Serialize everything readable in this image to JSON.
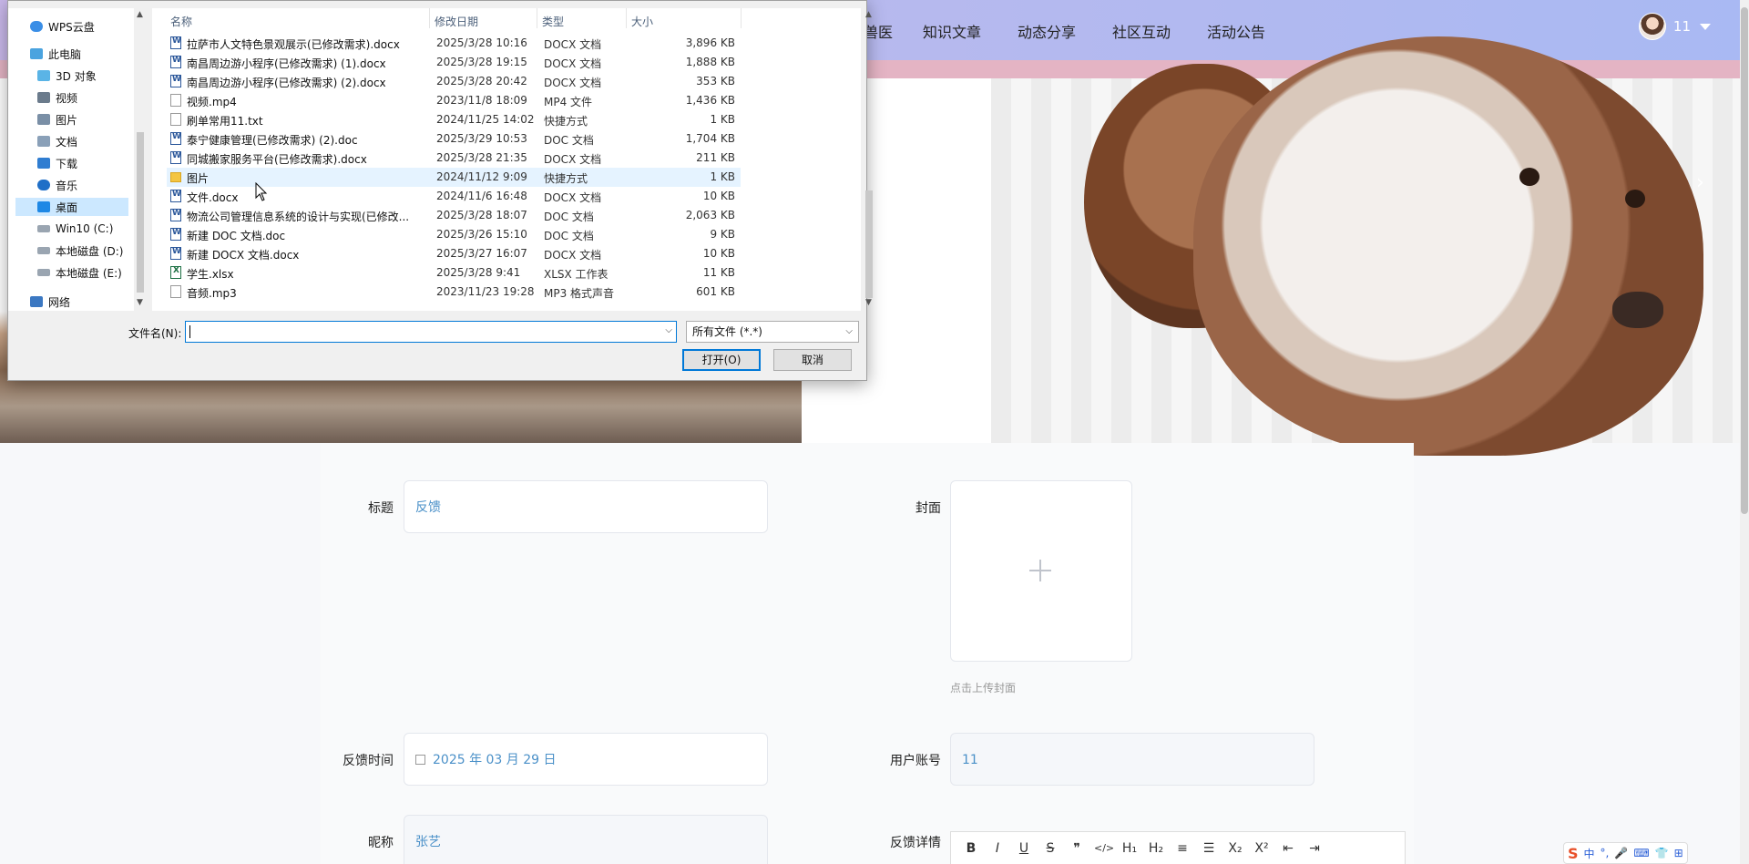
{
  "nav": {
    "items": [
      {
        "label": "兽医"
      },
      {
        "label": "知识文章"
      },
      {
        "label": "动态分享"
      },
      {
        "label": "社区互动"
      },
      {
        "label": "活动公告"
      }
    ],
    "user": "11"
  },
  "form": {
    "title_label": "标题",
    "title_value": "反馈",
    "cover_label": "封面",
    "cover_hint": "点击上传封面",
    "time_label": "反馈时间",
    "time_value": "2025 年 03 月 29 日",
    "account_label": "用户账号",
    "account_value": "11",
    "nickname_label": "昵称",
    "nickname_value": "张艺",
    "detail_label": "反馈详情"
  },
  "editor_toolbar": [
    "B",
    "I",
    "U",
    "S",
    "❞",
    "</>",
    "H₁",
    "H₂",
    "≡",
    "☰",
    "X₂",
    "X²",
    "⇤",
    "⇥"
  ],
  "ime": {
    "label": "中"
  },
  "dialog": {
    "nav_items": [
      {
        "label": "WPS云盘",
        "icon": "cloud-icon"
      },
      {
        "label": "此电脑",
        "icon": "computer-icon"
      },
      {
        "label": "3D 对象",
        "icon": "cube-icon"
      },
      {
        "label": "视频",
        "icon": "video-icon"
      },
      {
        "label": "图片",
        "icon": "picture-icon"
      },
      {
        "label": "文档",
        "icon": "document-icon"
      },
      {
        "label": "下载",
        "icon": "download-icon"
      },
      {
        "label": "音乐",
        "icon": "music-icon"
      },
      {
        "label": "桌面",
        "icon": "desktop-icon"
      },
      {
        "label": "Win10 (C:)",
        "icon": "drive-icon"
      },
      {
        "label": "本地磁盘 (D:)",
        "icon": "drive-icon"
      },
      {
        "label": "本地磁盘 (E:)",
        "icon": "drive-icon"
      },
      {
        "label": "网络",
        "icon": "network-icon"
      }
    ],
    "columns": {
      "name": "名称",
      "date": "修改日期",
      "type": "类型",
      "size": "大小"
    },
    "files": [
      {
        "name": "拉萨市人文特色景观展示(已修改需求).docx",
        "date": "2025/3/28 10:16",
        "type": "DOCX 文档",
        "size": "3,896 KB",
        "icon": "word"
      },
      {
        "name": "南昌周边游小程序(已修改需求) (1).docx",
        "date": "2025/3/28 19:15",
        "type": "DOCX 文档",
        "size": "1,888 KB",
        "icon": "word"
      },
      {
        "name": "南昌周边游小程序(已修改需求) (2).docx",
        "date": "2025/3/28 20:42",
        "type": "DOCX 文档",
        "size": "353 KB",
        "icon": "word"
      },
      {
        "name": "视频.mp4",
        "date": "2023/11/8 18:09",
        "type": "MP4 文件",
        "size": "1,436 KB",
        "icon": "generic"
      },
      {
        "name": "刷单常用11.txt",
        "date": "2024/11/25 14:02",
        "type": "快捷方式",
        "size": "1 KB",
        "icon": "generic"
      },
      {
        "name": "泰宁健康管理(已修改需求) (2).doc",
        "date": "2025/3/29 10:53",
        "type": "DOC 文档",
        "size": "1,704 KB",
        "icon": "word"
      },
      {
        "name": "同城搬家服务平台(已修改需求).docx",
        "date": "2025/3/28 21:35",
        "type": "DOCX 文档",
        "size": "211 KB",
        "icon": "word"
      },
      {
        "name": "图片",
        "date": "2024/11/12 9:09",
        "type": "快捷方式",
        "size": "1 KB",
        "icon": "folder"
      },
      {
        "name": "文件.docx",
        "date": "2024/11/6 16:48",
        "type": "DOCX 文档",
        "size": "10 KB",
        "icon": "word"
      },
      {
        "name": "物流公司管理信息系统的设计与实现(已修改...",
        "date": "2025/3/28 18:07",
        "type": "DOC 文档",
        "size": "2,063 KB",
        "icon": "word"
      },
      {
        "name": "新建 DOC 文档.doc",
        "date": "2025/3/26 15:10",
        "type": "DOC 文档",
        "size": "9 KB",
        "icon": "word"
      },
      {
        "name": "新建 DOCX 文档.docx",
        "date": "2025/3/27 16:07",
        "type": "DOCX 文档",
        "size": "10 KB",
        "icon": "word"
      },
      {
        "name": "学生.xlsx",
        "date": "2025/3/28 9:41",
        "type": "XLSX 工作表",
        "size": "11 KB",
        "icon": "excel"
      },
      {
        "name": "音频.mp3",
        "date": "2023/11/23 19:28",
        "type": "MP3 格式声音",
        "size": "601 KB",
        "icon": "generic"
      }
    ],
    "filename_label": "文件名(N):",
    "filename_value": "",
    "filter_value": "所有文件 (*.*)",
    "open_button": "打开(O)",
    "cancel_button": "取消"
  }
}
